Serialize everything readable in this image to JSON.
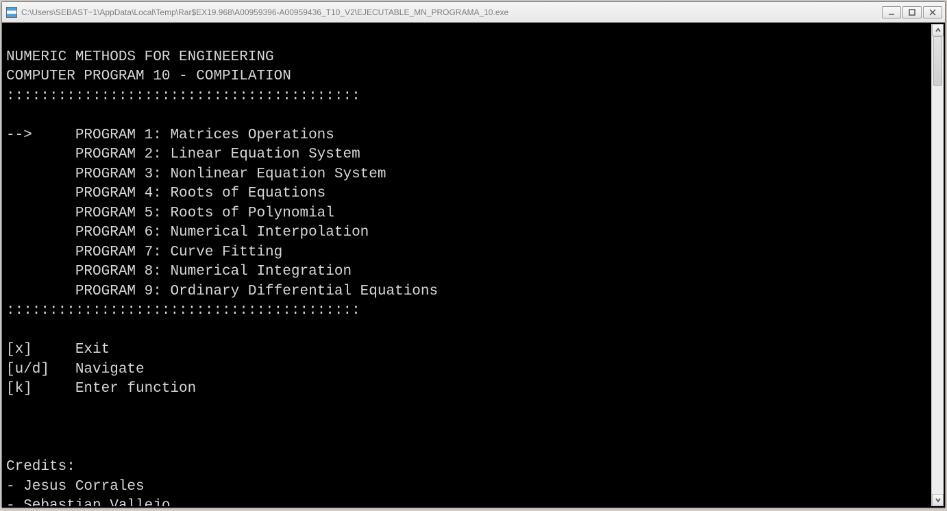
{
  "window": {
    "title": "C:\\Users\\SEBAST~1\\AppData\\Local\\Temp\\Rar$EX19.968\\A00959396-A00959436_T10_V2\\EJECUTABLE_MN_PROGRAMA_10.exe"
  },
  "term": {
    "header1": "NUMERIC METHODS FOR ENGINEERING",
    "header2": "COMPUTER PROGRAM 10 - COMPILATION",
    "divider": ":::::::::::::::::::::::::::::::::::::::::",
    "arrow": "-->",
    "programs": [
      {
        "label": "PROGRAM 1: Matrices Operations"
      },
      {
        "label": "PROGRAM 2: Linear Equation System"
      },
      {
        "label": "PROGRAM 3: Nonlinear Equation System"
      },
      {
        "label": "PROGRAM 4: Roots of Equations"
      },
      {
        "label": "PROGRAM 5: Roots of Polynomial"
      },
      {
        "label": "PROGRAM 6: Numerical Interpolation"
      },
      {
        "label": "PROGRAM 7: Curve Fitting"
      },
      {
        "label": "PROGRAM 8: Numerical Integration"
      },
      {
        "label": "PROGRAM 9: Ordinary Differential Equations"
      }
    ],
    "keys": [
      {
        "key": "[x]  ",
        "desc": "Exit"
      },
      {
        "key": "[u/d]",
        "desc": "Navigate"
      },
      {
        "key": "[k]  ",
        "desc": "Enter function"
      }
    ],
    "credits_heading": "Credits:",
    "credits": [
      "- Jesus Corrales",
      "- Sebastian Vallejo"
    ]
  }
}
